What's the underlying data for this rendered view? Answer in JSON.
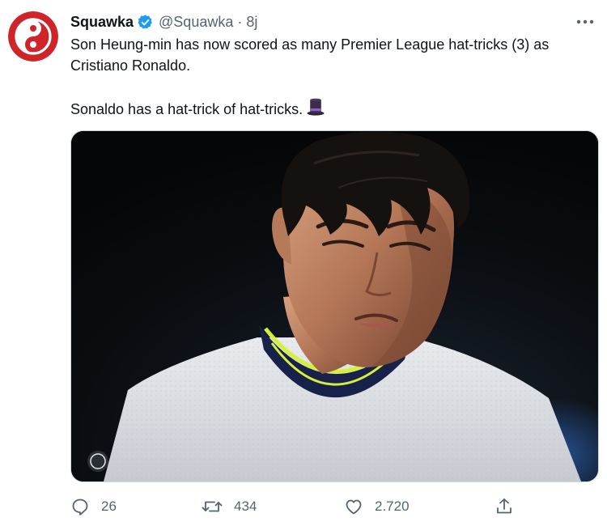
{
  "tweet": {
    "author": {
      "display_name": "Squawka",
      "handle": "@Squawka",
      "separator": "·",
      "time": "8j",
      "verified": true,
      "avatar_icon": "squawka-logo-icon"
    },
    "text": {
      "line1": "Son Heung-min has now scored as many Premier League hat-tricks (3) as Cristiano Ronaldo.",
      "line2": "Sonaldo has a hat-trick of hat-tricks.",
      "emoji": "top-hat-icon"
    },
    "media": {
      "description_icon": "player-photo-image"
    },
    "actions": {
      "reply_count": "26",
      "retweet_count": "434",
      "like_count": "2.720"
    }
  },
  "colors": {
    "brand_red": "#d0242b",
    "verified_blue": "#1d9bf0",
    "secondary_text": "#536471",
    "primary_text": "#0f1419"
  }
}
